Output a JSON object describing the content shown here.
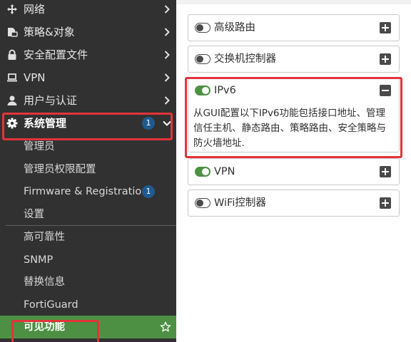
{
  "sidebar": {
    "top_items": [
      {
        "label": "网络",
        "icon": "network-arrows-icon"
      },
      {
        "label": "策略&对象",
        "icon": "policy-objects-icon"
      },
      {
        "label": "安全配置文件",
        "icon": "lock-icon"
      },
      {
        "label": "VPN",
        "icon": "laptop-icon"
      },
      {
        "label": "用户与认证",
        "icon": "user-icon"
      }
    ],
    "system": {
      "label": "系统管理",
      "icon": "gear-icon",
      "badge": "1"
    },
    "sub_items_group1": [
      {
        "label": "管理员"
      },
      {
        "label": "管理员权限配置"
      },
      {
        "label": "Firmware & Registration",
        "badge": "1"
      },
      {
        "label": "设置"
      }
    ],
    "sub_items_group2": [
      {
        "label": "高可靠性"
      },
      {
        "label": "SNMP"
      },
      {
        "label": "替换信息"
      },
      {
        "label": "FortiGuard"
      }
    ],
    "selected_item": {
      "label": "可见功能",
      "icon": "star-outline-icon"
    }
  },
  "features": [
    {
      "title": "高级路由",
      "enabled": false,
      "expanded": false
    },
    {
      "title": "交换机控制器",
      "enabled": false,
      "expanded": false
    },
    {
      "title": "IPv6",
      "enabled": true,
      "expanded": true,
      "description": "从GUI配置以下IPv6功能包括接口地址、管理信任主机、静态路由、策略路由、安全策略与防火墙地址."
    },
    {
      "title": "VPN",
      "enabled": true,
      "expanded": false
    },
    {
      "title": "WiFi控制器",
      "enabled": false,
      "expanded": false
    }
  ],
  "colors": {
    "sidebar_bg": "#313131",
    "accent_green": "#4d9044",
    "badge_blue": "#1f5a8e",
    "highlight_red": "#e2343a"
  }
}
